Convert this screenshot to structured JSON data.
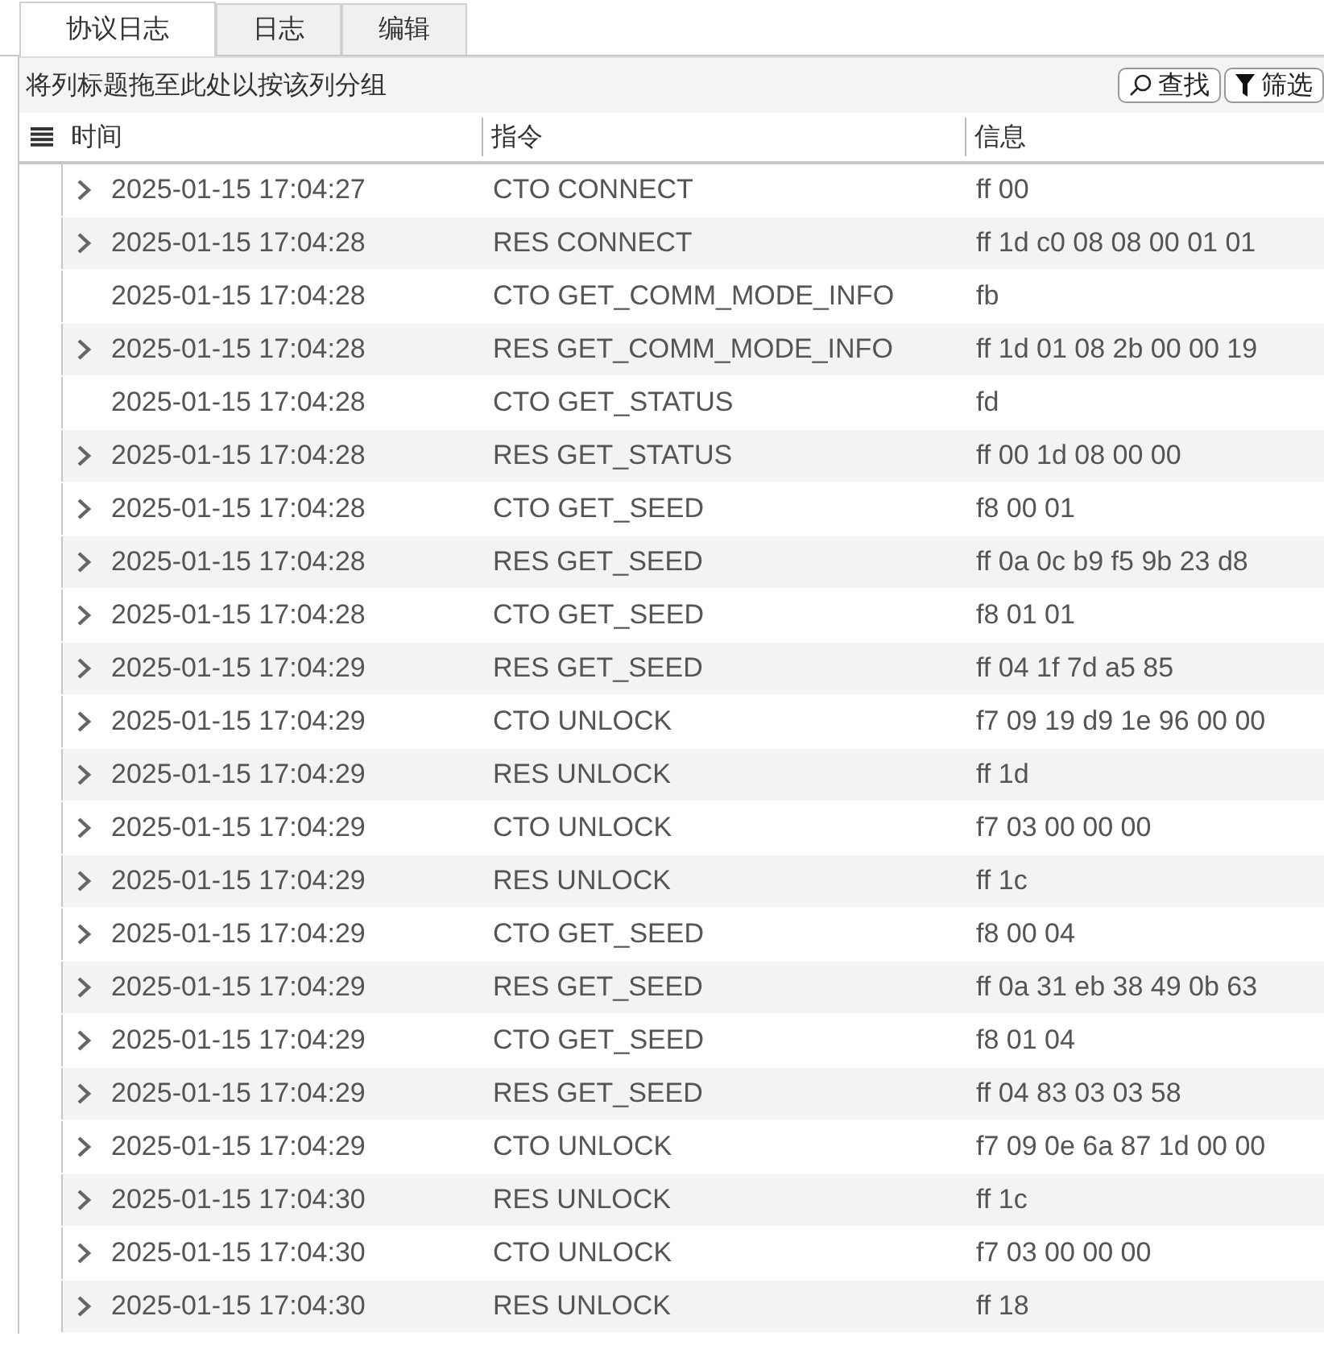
{
  "tabs": [
    {
      "label": "协议日志",
      "selected": true
    },
    {
      "label": "日志",
      "selected": false
    },
    {
      "label": "编辑",
      "selected": false
    }
  ],
  "group_panel": {
    "hint": "将列标题拖至此处以按该列分组",
    "buttons": [
      {
        "kind": "search",
        "label": "查找"
      },
      {
        "kind": "filter",
        "label": "筛选"
      }
    ]
  },
  "table": {
    "columns": [
      "时间",
      "指令",
      "信息"
    ],
    "rows": [
      {
        "expandable": true,
        "time": "2025-01-15 17:04:27",
        "command": "CTO CONNECT",
        "info": "ff 00"
      },
      {
        "expandable": true,
        "time": "2025-01-15 17:04:28",
        "command": "RES CONNECT",
        "info": "ff 1d c0 08 08 00 01 01"
      },
      {
        "expandable": false,
        "time": "2025-01-15 17:04:28",
        "command": "CTO GET_COMM_MODE_INFO",
        "info": "fb"
      },
      {
        "expandable": true,
        "time": "2025-01-15 17:04:28",
        "command": "RES GET_COMM_MODE_INFO",
        "info": "ff 1d 01 08 2b 00 00 19"
      },
      {
        "expandable": false,
        "time": "2025-01-15 17:04:28",
        "command": "CTO GET_STATUS",
        "info": "fd"
      },
      {
        "expandable": true,
        "time": "2025-01-15 17:04:28",
        "command": "RES GET_STATUS",
        "info": "ff 00 1d 08 00 00"
      },
      {
        "expandable": true,
        "time": "2025-01-15 17:04:28",
        "command": "CTO GET_SEED",
        "info": "f8 00 01"
      },
      {
        "expandable": true,
        "time": "2025-01-15 17:04:28",
        "command": "RES GET_SEED",
        "info": "ff 0a 0c b9 f5 9b 23 d8"
      },
      {
        "expandable": true,
        "time": "2025-01-15 17:04:28",
        "command": "CTO GET_SEED",
        "info": "f8 01 01"
      },
      {
        "expandable": true,
        "time": "2025-01-15 17:04:29",
        "command": "RES GET_SEED",
        "info": "ff 04 1f 7d a5 85"
      },
      {
        "expandable": true,
        "time": "2025-01-15 17:04:29",
        "command": "CTO UNLOCK",
        "info": "f7 09 19 d9 1e 96 00 00"
      },
      {
        "expandable": true,
        "time": "2025-01-15 17:04:29",
        "command": "RES UNLOCK",
        "info": "ff 1d"
      },
      {
        "expandable": true,
        "time": "2025-01-15 17:04:29",
        "command": "CTO UNLOCK",
        "info": "f7 03 00 00 00"
      },
      {
        "expandable": true,
        "time": "2025-01-15 17:04:29",
        "command": "RES UNLOCK",
        "info": "ff 1c"
      },
      {
        "expandable": true,
        "time": "2025-01-15 17:04:29",
        "command": "CTO GET_SEED",
        "info": "f8 00 04"
      },
      {
        "expandable": true,
        "time": "2025-01-15 17:04:29",
        "command": "RES GET_SEED",
        "info": "ff 0a 31 eb 38 49 0b 63"
      },
      {
        "expandable": true,
        "time": "2025-01-15 17:04:29",
        "command": "CTO GET_SEED",
        "info": "f8 01 04"
      },
      {
        "expandable": true,
        "time": "2025-01-15 17:04:29",
        "command": "RES GET_SEED",
        "info": "ff 04 83 03 03 58"
      },
      {
        "expandable": true,
        "time": "2025-01-15 17:04:29",
        "command": "CTO UNLOCK",
        "info": "f7 09 0e 6a 87 1d 00 00"
      },
      {
        "expandable": true,
        "time": "2025-01-15 17:04:30",
        "command": "RES UNLOCK",
        "info": "ff 1c"
      },
      {
        "expandable": true,
        "time": "2025-01-15 17:04:30",
        "command": "CTO UNLOCK",
        "info": "f7 03 00 00 00"
      },
      {
        "expandable": true,
        "time": "2025-01-15 17:04:30",
        "command": "RES UNLOCK",
        "info": "ff 18"
      }
    ]
  }
}
